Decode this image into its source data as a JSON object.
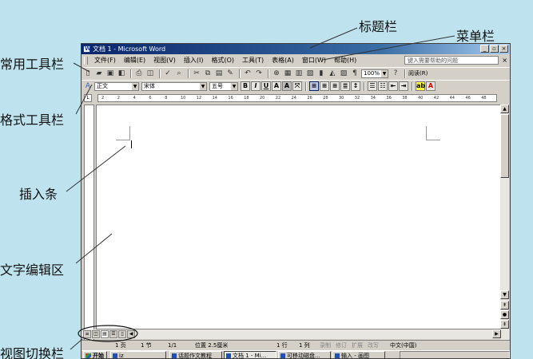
{
  "annotations": {
    "title_bar": "标题栏",
    "menu_bar": "菜单栏",
    "standard_toolbar": "常用工具栏",
    "format_toolbar": "格式工具栏",
    "insertion_bar": "插入条",
    "edit_area": "文字编辑区",
    "view_switch": "视图切换栏"
  },
  "window": {
    "title": "文档 1 - Microsoft Word",
    "buttons": [
      "_",
      "▫",
      "×"
    ]
  },
  "menu": {
    "items": [
      "文件(F)",
      "编辑(E)",
      "视图(V)",
      "插入(I)",
      "格式(O)",
      "工具(T)",
      "表格(A)",
      "窗口(W)",
      "帮助(H)"
    ],
    "help_placeholder": "键入需要帮助的问题",
    "close": "×"
  },
  "standard_toolbar": {
    "zoom": "100%",
    "read_label": "阅读(R)"
  },
  "format_toolbar": {
    "style": "正文",
    "font": "宋体",
    "size": "五号",
    "bold": "B",
    "italic": "I",
    "underline": "U"
  },
  "ruler": {
    "ticks": [
      "2",
      "2",
      "4",
      "6",
      "8",
      "10",
      "12",
      "14",
      "16",
      "18",
      "20",
      "22",
      "24",
      "26",
      "28",
      "30",
      "32",
      "34",
      "36",
      "38",
      "40",
      "42",
      "44",
      "46",
      "48"
    ]
  },
  "status_bar": {
    "page": "1 页",
    "section": "1 节",
    "page_count": "1/1",
    "position": "位置 2.5厘米",
    "line": "1 行",
    "column": "1 列",
    "rec": "录制",
    "trk": "修订",
    "ext": "扩展",
    "ovr": "改写",
    "language": "中文(中国)"
  },
  "taskbar": {
    "start": "开始",
    "tasks": [
      "iz",
      "话题作文教程",
      "文档 1 - Mi...",
      "可移动磁盘...",
      "输入 - 画图"
    ]
  }
}
